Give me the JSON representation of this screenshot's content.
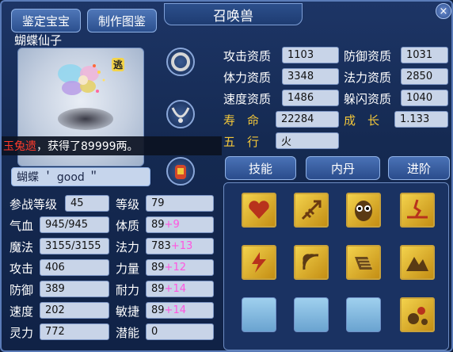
{
  "buttons": {
    "appraise": "鉴定宝宝",
    "illustrate": "制作图鉴",
    "close": "×"
  },
  "window": {
    "title": "召唤兽"
  },
  "pet": {
    "name": "蝴蝶仙子",
    "tag": "逃",
    "nickname": "蝴蝶 ＇ good ＂"
  },
  "notice": {
    "prefix": "玉兔遗",
    "suffix": "，获得了89999两。"
  },
  "aptitude": {
    "attack_label": "攻击资质",
    "attack": "1103",
    "defense_label": "防御资质",
    "defense": "1031",
    "stamina_label": "体力资质",
    "stamina": "3348",
    "magic_label": "法力资质",
    "magic": "2850",
    "speed_label": "速度资质",
    "speed": "1486",
    "dodge_label": "躲闪资质",
    "dodge": "1040",
    "life_label": "寿　命",
    "life": "22284",
    "growth_label": "成　长",
    "growth": "1.133",
    "element_label": "五　行",
    "element": "火"
  },
  "stats": {
    "level_req_label": "参战等级",
    "level_req": "45",
    "level_label": "等级",
    "level": "79",
    "hp_label": "气血",
    "hp": "945/945",
    "con_label": "体质",
    "con": "89",
    "con_plus": "+9",
    "mp_label": "魔法",
    "mp": "3155/3155",
    "mag_label": "法力",
    "mag": "783",
    "mag_plus": "+13",
    "atk_label": "攻击",
    "atk": "406",
    "str_label": "力量",
    "str": "89",
    "str_plus": "+12",
    "def_label": "防御",
    "def": "389",
    "end_label": "耐力",
    "end": "89",
    "end_plus": "+14",
    "spd_label": "速度",
    "spd": "202",
    "agi_label": "敏捷",
    "agi": "89",
    "agi_plus": "+14",
    "spirit_label": "灵力",
    "spirit": "772",
    "pot_label": "潜能",
    "pot": "0"
  },
  "tabs": {
    "skills": "技能",
    "inner": "内丹",
    "advance": "进阶"
  },
  "skills": [
    "heart-skill",
    "arrow-skill",
    "owl-skill",
    "crack-skill",
    "thunder-skill",
    "sonic-skill",
    "charge-skill",
    "mountain-skill",
    "empty",
    "empty",
    "empty",
    "meteor-skill"
  ],
  "colors": {
    "accent": "#f2c63a",
    "plus": "#ff55e0",
    "notice_name": "#ff3a2a"
  }
}
